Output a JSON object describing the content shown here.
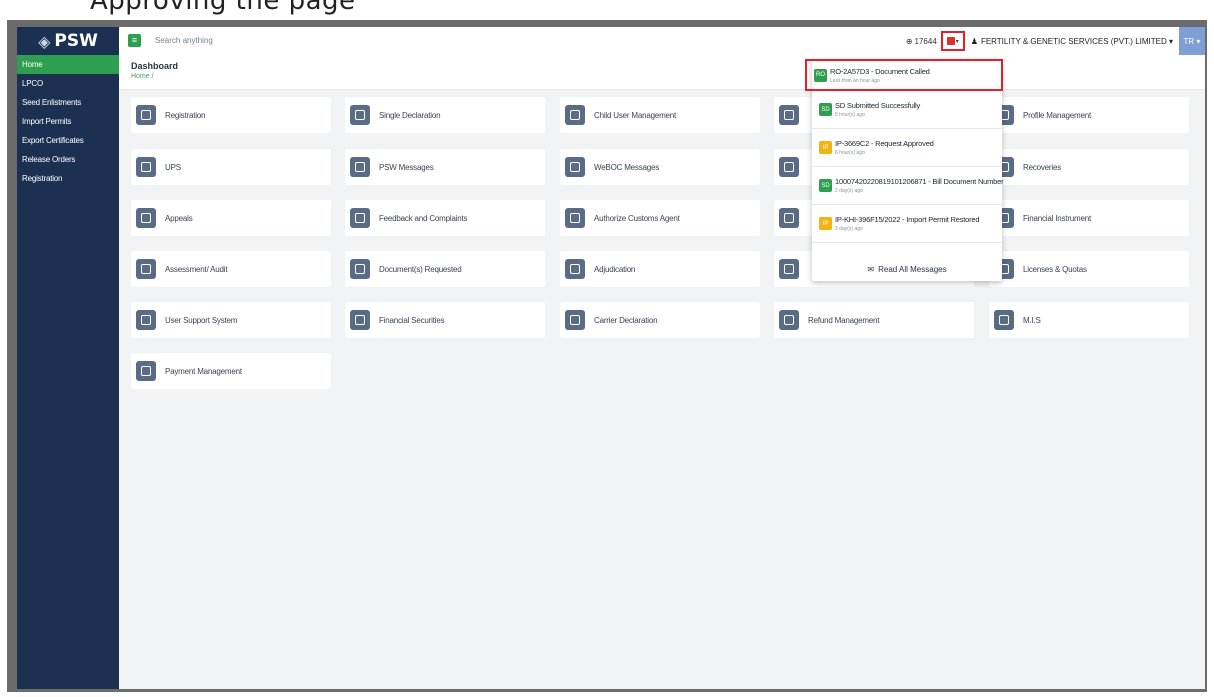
{
  "caption": "Approving the page",
  "app": {
    "logo": "PSW",
    "logo_mark": "◈",
    "sidebar": {
      "items": [
        {
          "label": "Home",
          "active": true
        },
        {
          "label": "LPCO",
          "active": false
        },
        {
          "label": "Seed Enlistments",
          "active": false
        },
        {
          "label": "Import Permits",
          "active": false
        },
        {
          "label": "Export Certificates",
          "active": false
        },
        {
          "label": "Release Orders",
          "active": false
        },
        {
          "label": "Registration",
          "active": false
        }
      ]
    },
    "header": {
      "menu_icon": "≡",
      "search_placeholder": "Search anything",
      "counter": "17644",
      "company": "FERTILITY & GENETIC SERVICES (PVT.) LIMITED ▾",
      "avatar": "TR ▾"
    },
    "page": {
      "title": "Dashboard",
      "breadcrumb": "Home /"
    },
    "cards": [
      {
        "label": "Registration",
        "icon": "document-arrow-icon"
      },
      {
        "label": "Single Declaration",
        "icon": "building-icon"
      },
      {
        "label": "Child User Management",
        "icon": "document-arrow-icon"
      },
      {
        "label": "",
        "icon": "document-icon"
      },
      {
        "label": "Profile Management",
        "icon": "gear-user-icon"
      },
      {
        "label": "UPS",
        "icon": "diamond-grid-icon"
      },
      {
        "label": "PSW Messages",
        "icon": "envelope-icon"
      },
      {
        "label": "WeBOC Messages",
        "icon": "envelope-icon"
      },
      {
        "label": "",
        "icon": "document-gear-icon"
      },
      {
        "label": "Recoveries",
        "icon": "document-check-icon"
      },
      {
        "label": "Appeals",
        "icon": "scales-icon"
      },
      {
        "label": "Feedback and Complaints",
        "icon": "question-doc-icon"
      },
      {
        "label": "Authorize Customs Agent",
        "icon": "user-check-icon"
      },
      {
        "label": "",
        "icon": "document-time-icon"
      },
      {
        "label": "Financial Instrument",
        "icon": "document-money-icon"
      },
      {
        "label": "Assessment/ Audit",
        "icon": "document-search-icon"
      },
      {
        "label": "Document(s) Requested",
        "icon": "document-list-icon"
      },
      {
        "label": "Adjudication",
        "icon": "gavel-icon"
      },
      {
        "label": "",
        "icon": "document-icon"
      },
      {
        "label": "Licenses & Quotas",
        "icon": "license-icon"
      },
      {
        "label": "User Support System",
        "icon": "phone-icon"
      },
      {
        "label": "Financial Securities",
        "icon": "shield-icon"
      },
      {
        "label": "Carrier Declaration",
        "icon": "flag-icon"
      },
      {
        "label": "Refund Management",
        "icon": "refund-icon"
      },
      {
        "label": "M.I.S",
        "icon": "grid-icon"
      },
      {
        "label": "Payment Management",
        "icon": "payment-icon"
      }
    ],
    "notifications": [
      {
        "badge": "RO",
        "title": "RO-2A57D3 - Document Called",
        "time": "Less than an hour ago",
        "color": "#2e9e4f",
        "highlighted": true
      },
      {
        "badge": "SD",
        "title": "SD Submitted Successfully",
        "time": "5 hour(s) ago",
        "color": "#2e9e4f",
        "highlighted": false
      },
      {
        "badge": "IP",
        "title": "IP-3669C2 - Request Approved",
        "time": "6 hour(s) ago",
        "color": "#f2b413",
        "highlighted": false
      },
      {
        "badge": "SD",
        "title": "1000742022081910120687​1 - Bill Document Number",
        "time": "2 day(s) ago",
        "color": "#2e9e4f",
        "highlighted": false
      },
      {
        "badge": "IP",
        "title": "IP-KHI-396F15/2022 - Import Permit Restored",
        "time": "3 day(s) ago",
        "color": "#f2b413",
        "highlighted": false
      }
    ],
    "read_all": "Read All Messages",
    "colors": {
      "sidebar": "#1c3152",
      "accent": "#2e9e4f",
      "highlight": "#e0202a",
      "icon_tile": "#5a6b86"
    }
  }
}
